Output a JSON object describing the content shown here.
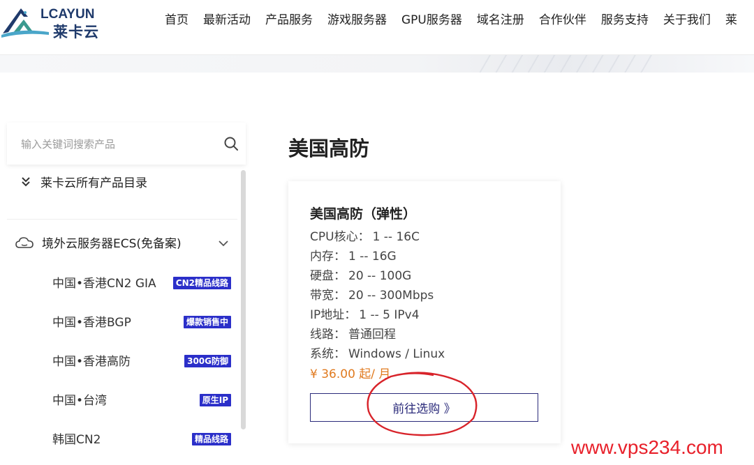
{
  "header": {
    "logo": {
      "latin": "LCAYUN",
      "cn": "莱卡云"
    },
    "nav": [
      "首页",
      "最新活动",
      "产品服务",
      "游戏服务器",
      "GPU服务器",
      "域名注册",
      "合作伙伴",
      "服务支持",
      "关于我们",
      "莱"
    ]
  },
  "sidebar": {
    "search": {
      "placeholder": "输入关键词搜索产品",
      "icon": "search-icon"
    },
    "catalog_label": "莱卡云所有产品目录",
    "ecs_label": "境外云服务器ECS(免备案)",
    "items": [
      {
        "name": "中国•香港CN2 GIA",
        "badge": "CN2精品线路"
      },
      {
        "name": "中国•香港BGP",
        "badge": "爆款销售中"
      },
      {
        "name": "中国•香港高防",
        "badge": "300G防御"
      },
      {
        "name": "中国•台湾",
        "badge": "原生IP"
      },
      {
        "name": "韩国CN2",
        "badge": "精品线路"
      }
    ],
    "colors": {
      "badge_bg": "#2b2fc9"
    }
  },
  "main": {
    "title": "美国高防",
    "card": {
      "title": "美国高防（弹性）",
      "specs": [
        {
          "label": "CPU核心：",
          "value": "1 -- 16C"
        },
        {
          "label": "内存：",
          "value": "1 -- 16G"
        },
        {
          "label": "硬盘：",
          "value": "20 -- 100G"
        },
        {
          "label": "带宽：",
          "value": "20 -- 300Mbps"
        },
        {
          "label": "IP地址：",
          "value": "1 -- 5 IPv4"
        },
        {
          "label": "线路：",
          "value": "普通回程"
        },
        {
          "label": "系统：",
          "value": "Windows / Linux"
        }
      ],
      "price": "¥ 36.00 起/ 月",
      "button": "前往选购 》",
      "colors": {
        "price": "#e07a1f",
        "button": "#2a2a7a"
      }
    }
  },
  "watermark": "www.vps234.com",
  "annotation": {
    "color": "#d8232a"
  }
}
